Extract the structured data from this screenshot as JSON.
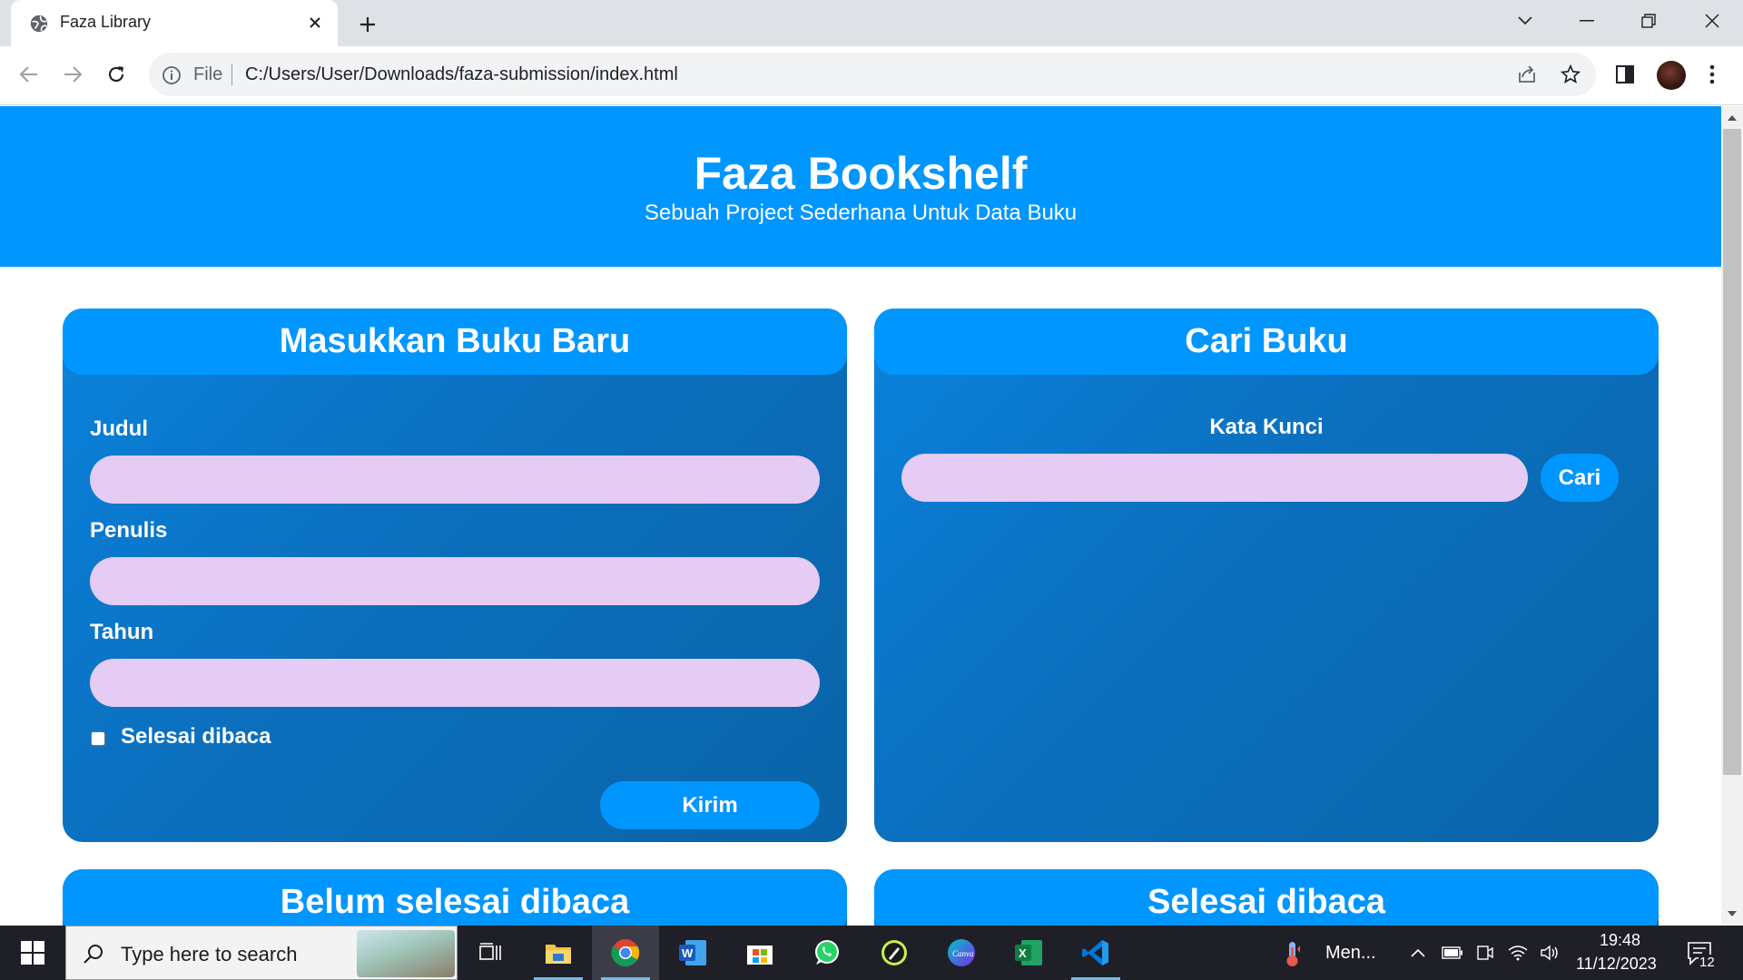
{
  "browser": {
    "tab_title": "Faza Library",
    "omnibox": {
      "scheme_label": "File",
      "url": "C:/Users/User/Downloads/faza-submission/index.html"
    }
  },
  "page": {
    "header": {
      "title": "Faza Bookshelf",
      "subtitle": "Sebuah Project Sederhana Untuk Data Buku"
    },
    "input_card": {
      "title": "Masukkan Buku Baru",
      "fields": {
        "judul_label": "Judul",
        "judul_value": "",
        "penulis_label": "Penulis",
        "penulis_value": "",
        "tahun_label": "Tahun",
        "tahun_value": ""
      },
      "checkbox_label": "Selesai dibaca",
      "checkbox_checked": false,
      "submit_label": "Kirim"
    },
    "search_card": {
      "title": "Cari Buku",
      "label": "Kata Kunci",
      "input_value": "",
      "button_label": "Cari"
    },
    "shelves": {
      "unread_title": "Belum selesai dibaca",
      "read_title": "Selesai dibaca"
    }
  },
  "taskbar": {
    "search_placeholder": "Type here to search",
    "weather_label": "Men...",
    "clock_time": "19:48",
    "clock_date": "11/12/2023",
    "notification_count": "12"
  },
  "colors": {
    "brand_blue": "#0096ff",
    "card_gradient_dark": "#0a64a8",
    "input_bg": "#e5ccf5"
  }
}
